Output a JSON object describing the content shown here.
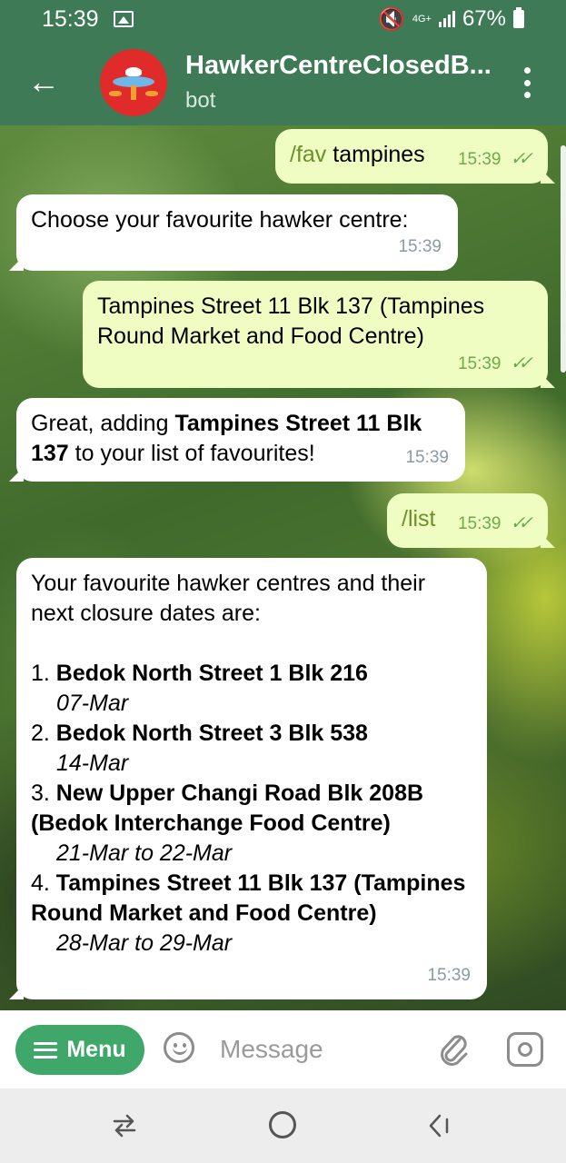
{
  "status_bar": {
    "time": "15:39",
    "network": "4G+",
    "battery": "67%"
  },
  "header": {
    "title": "HawkerCentreClosedB...",
    "subtitle": "bot",
    "back_icon": "arrow-left-icon",
    "menu_icon": "kebab-menu-icon"
  },
  "messages": [
    {
      "dir": "out",
      "cmd": "/fav",
      "text": " tampines",
      "time": "15:39"
    },
    {
      "dir": "in",
      "text": "Choose your favourite hawker centre:",
      "time": "15:39"
    },
    {
      "dir": "out",
      "text": "Tampines Street 11 Blk 137 (Tampines Round Market and Food Centre)",
      "time": "15:39"
    },
    {
      "dir": "in",
      "pre": "Great, adding ",
      "bold": "Tampines Street 11 Blk 137",
      "post": " to your list of favourites!",
      "time": "15:39"
    },
    {
      "dir": "out",
      "cmd": "/list",
      "time": "15:39"
    },
    {
      "dir": "in",
      "intro": "Your favourite hawker centres and their next closure dates are:",
      "items": [
        {
          "num": "1. ",
          "name": "Bedok North Street 1 Blk 216",
          "dates": "07-Mar"
        },
        {
          "num": "2. ",
          "name": "Bedok North Street 3 Blk 538",
          "dates": "14-Mar"
        },
        {
          "num": "3. ",
          "name": "New Upper Changi Road Blk 208B (Bedok Interchange Food Centre)",
          "dates": "21-Mar to 22-Mar"
        },
        {
          "num": "4. ",
          "name": "Tampines Street 11 Blk 137 (Tampines Round Market and Food Centre)",
          "dates": "28-Mar to 29-Mar"
        }
      ],
      "time": "15:39"
    }
  ],
  "input_bar": {
    "menu_label": "Menu",
    "placeholder": "Message"
  },
  "colors": {
    "header": "#3d7a55",
    "outgoing_bubble": "#effdc2",
    "menu_button": "#3fa76a"
  }
}
